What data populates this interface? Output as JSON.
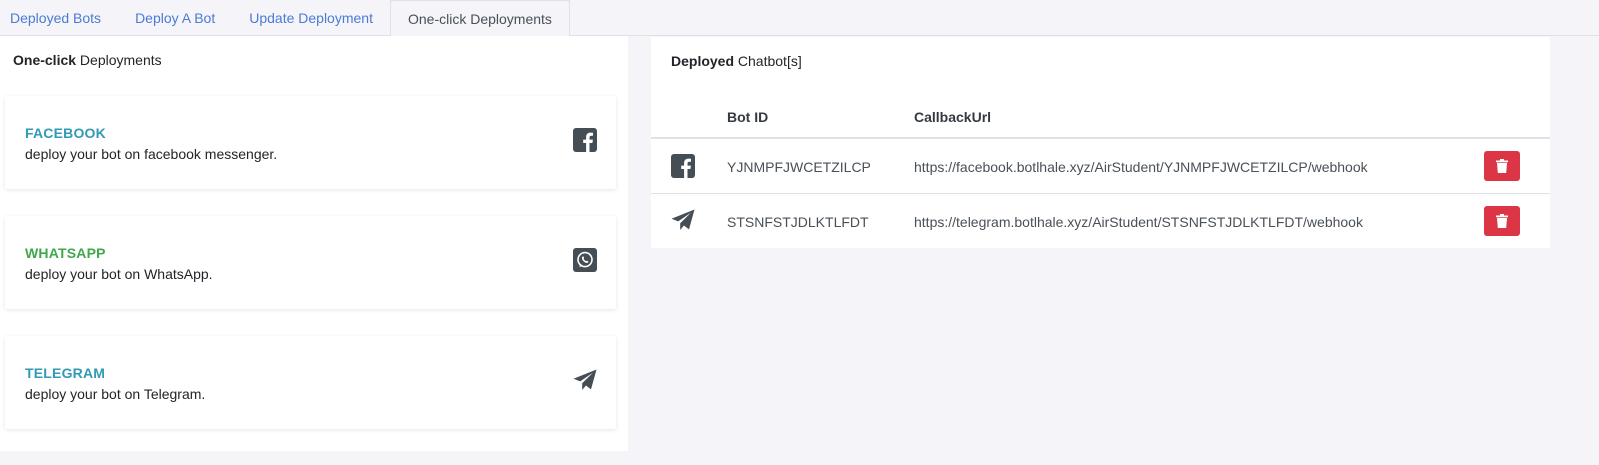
{
  "tabs": [
    {
      "label": "Deployed Bots",
      "active": false
    },
    {
      "label": "Deploy A Bot",
      "active": false
    },
    {
      "label": "Update Deployment",
      "active": false
    },
    {
      "label": "One-click Deployments",
      "active": true
    }
  ],
  "left_panel": {
    "title_bold": "One-click",
    "title_rest": " Deployments",
    "cards": [
      {
        "title": "FACEBOOK",
        "description": "deploy your bot on facebook messenger.",
        "icon": "facebook-square-icon",
        "title_color": "#2f9bb4"
      },
      {
        "title": "WHATSAPP",
        "description": "deploy your bot on WhatsApp.",
        "icon": "whatsapp-square-icon",
        "title_color": "#3ea84a"
      },
      {
        "title": "TELEGRAM",
        "description": "deploy your bot on Telegram.",
        "icon": "telegram-plane-icon",
        "title_color": "#2f9bb4"
      }
    ]
  },
  "right_panel": {
    "title_bold": "Deployed",
    "title_rest": " Chatbot[s]",
    "columns": [
      "Bot ID",
      "CallbackUrl"
    ],
    "rows": [
      {
        "icon": "facebook-square-icon",
        "bot_id": "YJNMPFJWCETZILCP",
        "callback_url": "https://facebook.botlhale.xyz/AirStudent/YJNMPFJWCETZILCP/webhook"
      },
      {
        "icon": "telegram-plane-icon",
        "bot_id": "STSNFSTJDLKTLFDT",
        "callback_url": "https://telegram.botlhale.xyz/AirStudent/STSNFSTJDLKTLFDT/webhook"
      }
    ]
  },
  "colors": {
    "link": "#4b7bd4",
    "danger": "#dc3545",
    "icon": "#454d55"
  }
}
